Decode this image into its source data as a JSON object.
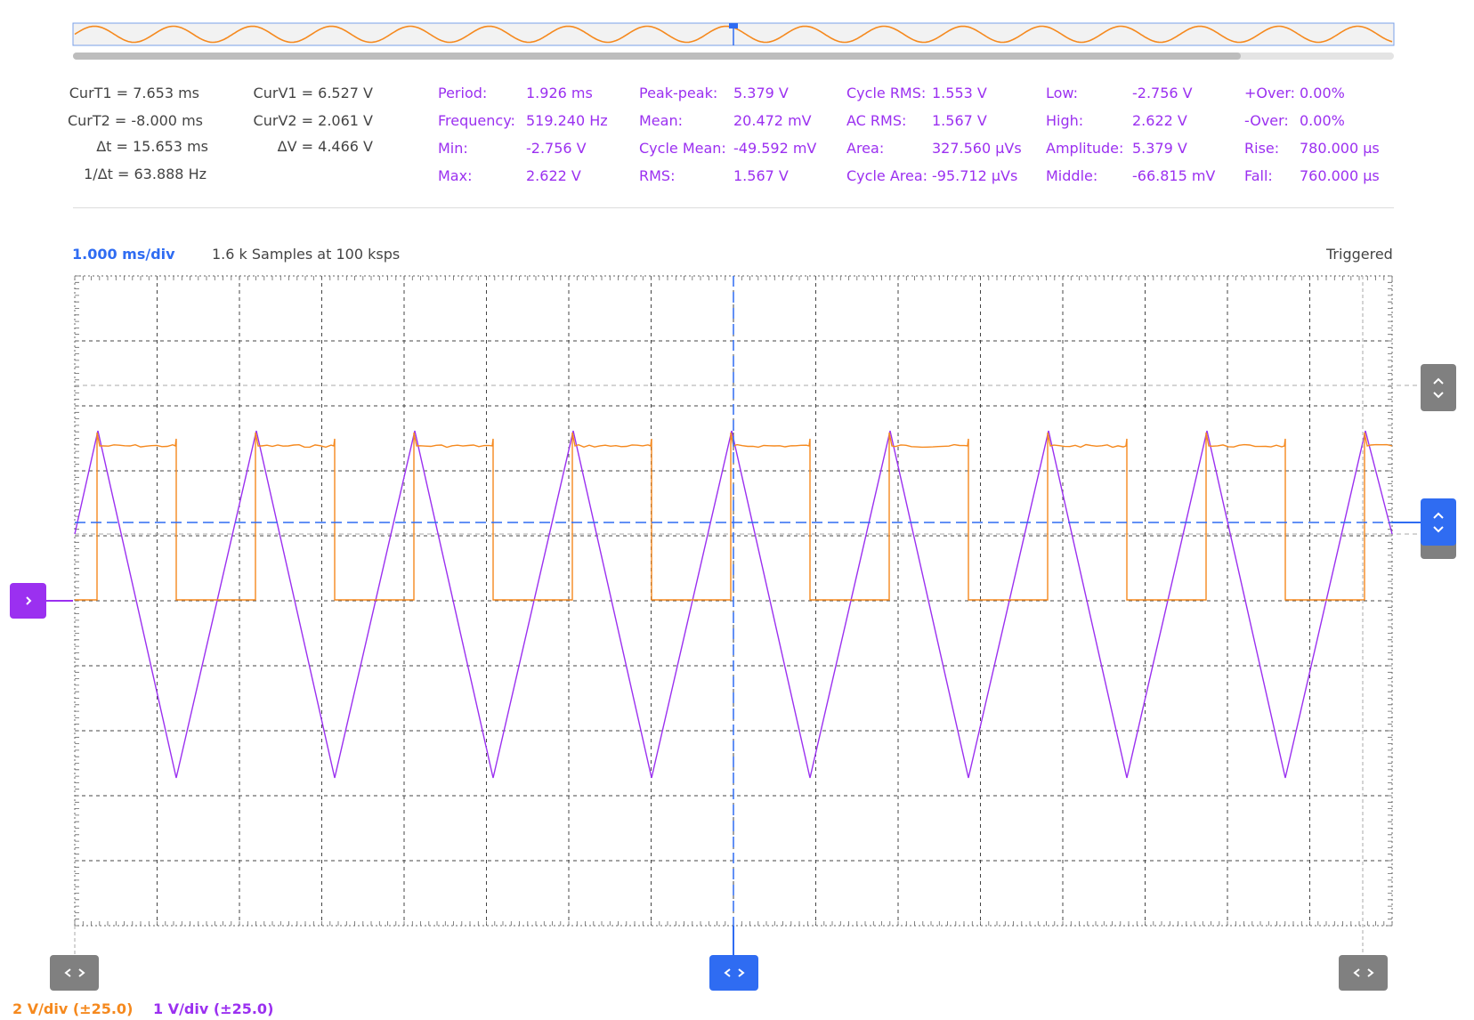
{
  "cursors": {
    "curT1": {
      "label": "CurT1 =",
      "value": "7.653 ms"
    },
    "curT2": {
      "label": "CurT2 =",
      "value": "-8.000 ms"
    },
    "deltaT": {
      "label": "Δt =",
      "value": "15.653 ms"
    },
    "invDeltaT": {
      "label": "1/Δt =",
      "value": "63.888 Hz"
    },
    "curV1": {
      "label": "CurV1 =",
      "value": "6.527 V"
    },
    "curV2": {
      "label": "CurV2 =",
      "value": "2.061 V"
    },
    "deltaV": {
      "label": "ΔV =",
      "value": "4.466 V"
    }
  },
  "measurements": [
    [
      {
        "label": "Period:",
        "value": "1.926 ms"
      },
      {
        "label": "Frequency:",
        "value": "519.240 Hz"
      },
      {
        "label": "Min:",
        "value": "-2.756 V"
      },
      {
        "label": "Max:",
        "value": "2.622 V"
      }
    ],
    [
      {
        "label": "Peak-peak:",
        "value": "5.379 V"
      },
      {
        "label": "Mean:",
        "value": "20.472 mV"
      },
      {
        "label": "Cycle Mean:",
        "value": "-49.592 mV"
      },
      {
        "label": "RMS:",
        "value": "1.567 V"
      }
    ],
    [
      {
        "label": "Cycle RMS:",
        "value": "1.553 V"
      },
      {
        "label": "AC RMS:",
        "value": "1.567 V"
      },
      {
        "label": "Area:",
        "value": "327.560 µVs"
      },
      {
        "label": "Cycle Area:",
        "value": "-95.712 µVs"
      }
    ],
    [
      {
        "label": "Low:",
        "value": "-2.756 V"
      },
      {
        "label": "High:",
        "value": "2.622 V"
      },
      {
        "label": "Amplitude:",
        "value": "5.379 V"
      },
      {
        "label": "Middle:",
        "value": "-66.815 mV"
      }
    ],
    [
      {
        "label": "+Over:",
        "value": "0.00%"
      },
      {
        "label": "-Over:",
        "value": "0.00%"
      },
      {
        "label": "Rise:",
        "value": "780.000 µs"
      },
      {
        "label": "Fall:",
        "value": "760.000 µs"
      }
    ]
  ],
  "acquisition": {
    "timebase": "1.000 ms/div",
    "samples": "1.6 k Samples at 100 ksps",
    "status": "Triggered"
  },
  "channels": [
    {
      "label": "2 V/div (±25.0)",
      "color": "#f5891e"
    },
    {
      "label": "1 V/div (±25.0)",
      "color": "#9b30f0"
    }
  ],
  "colors": {
    "channel1": "#f5891e",
    "channel2": "#9b30f0",
    "cursor": "#2f6cf2",
    "grid": "#333333",
    "button_grey": "#808080"
  },
  "buttons": {
    "left_time_cursor": "chevron-left-right-icon",
    "center_time_cursor": "chevron-left-right-icon",
    "right_time_cursor": "chevron-left-right-icon",
    "voltage_cursor_upper": "chevron-up-down-icon",
    "voltage_cursor_lower": "chevron-up-down-icon",
    "channel_offset_marker": "chevron-right-icon"
  }
}
